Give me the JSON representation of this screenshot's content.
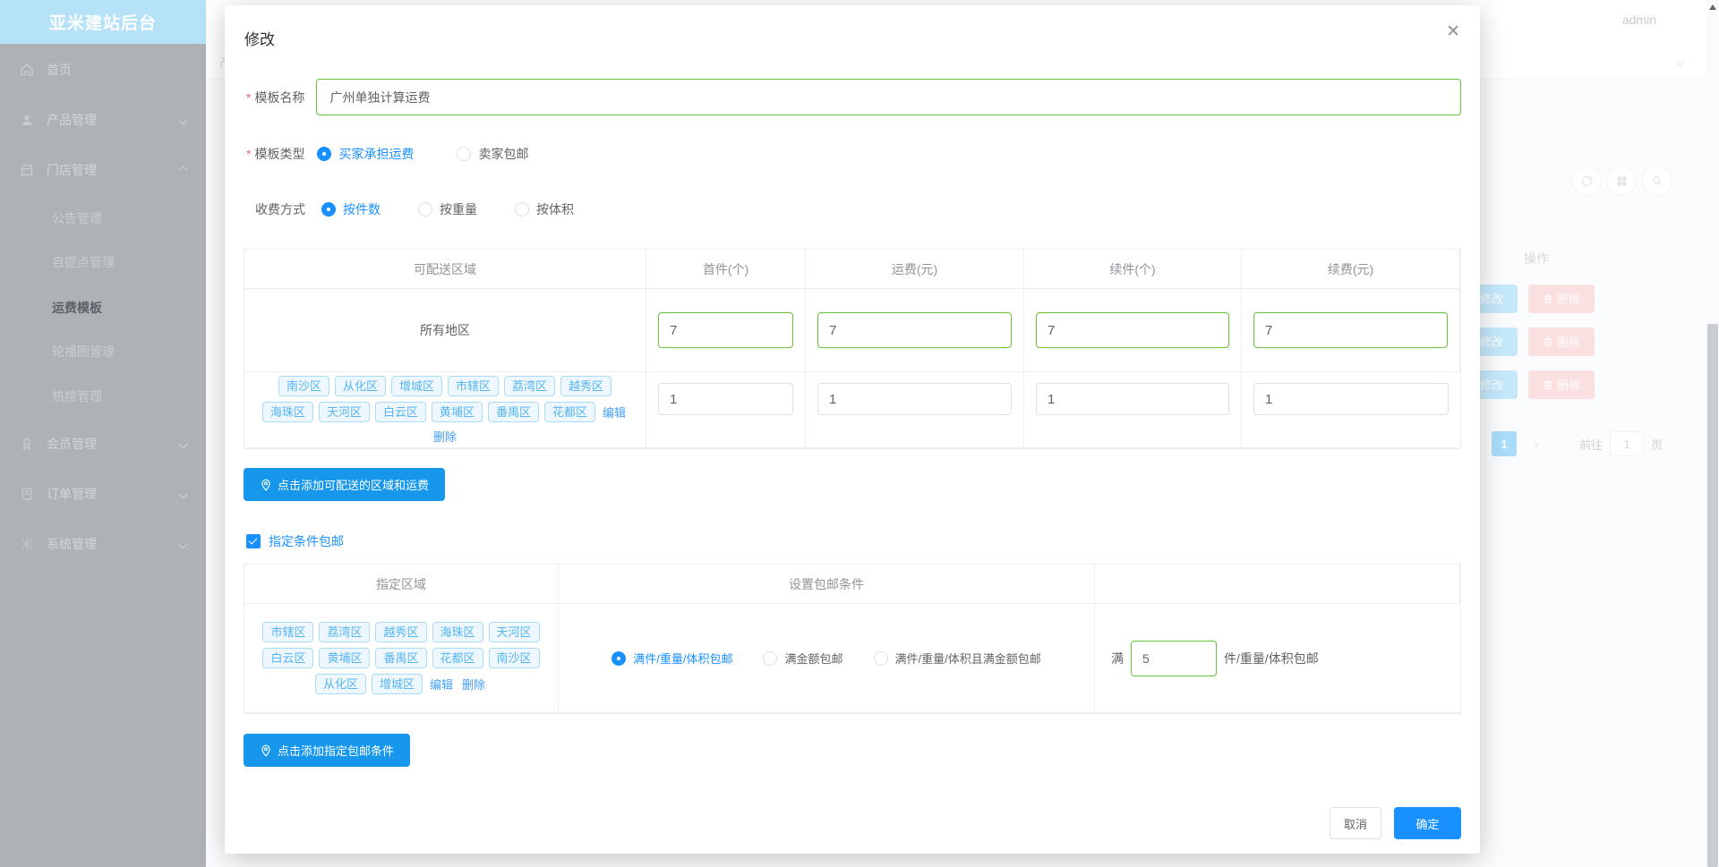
{
  "sidebar": {
    "logo": "亚米建站后台",
    "items": [
      {
        "label": "首页"
      },
      {
        "label": "产品管理"
      },
      {
        "label": "门店管理"
      },
      {
        "label": "会员管理"
      },
      {
        "label": "订单管理"
      },
      {
        "label": "系统管理"
      }
    ],
    "store_children": [
      "公告管理",
      "自提点管理",
      "运费模板",
      "轮播图管理",
      "热搜管理"
    ],
    "active_item": "运费模板"
  },
  "header": {
    "username": "admin"
  },
  "breadcrumb": {
    "visible_text": "产品"
  },
  "background_table": {
    "ops_header": "操作",
    "edit_label": "修改",
    "delete_label": "删除",
    "row_count": 3,
    "pagination": {
      "active_page": "1",
      "goto_label": "前往",
      "page_input": "1",
      "page_suffix": "页"
    }
  },
  "modal": {
    "title": "修改",
    "close_icon": "✕",
    "name_field": {
      "label": "模板名称",
      "value": "广州单独计算运费"
    },
    "type_field": {
      "label": "模板类型",
      "options": [
        "买家承担运费",
        "卖家包邮"
      ],
      "selected": "买家承担运费"
    },
    "method_field": {
      "label": "收费方式",
      "options": [
        "按件数",
        "按重量",
        "按体积"
      ],
      "selected": "按件数"
    },
    "shipping_table": {
      "headers": [
        "可配送区域",
        "首件(个)",
        "运费(元)",
        "续件(个)",
        "续费(元)"
      ],
      "row_all": {
        "region": "所有地区",
        "first": "7",
        "fee": "7",
        "next": "7",
        "next_fee": "7"
      },
      "row_tags": {
        "tags": [
          "南沙区",
          "从化区",
          "增城区",
          "市辖区",
          "荔湾区",
          "越秀区",
          "海珠区",
          "天河区",
          "白云区",
          "黄埔区",
          "番禺区",
          "花都区"
        ],
        "edit": "编辑",
        "delete": "删除",
        "first": "1",
        "fee": "1",
        "next": "1",
        "next_fee": "1"
      }
    },
    "add_region_button": "点击添加可配送的区域和运费",
    "free_shipping": {
      "checkbox_label": "指定条件包邮",
      "checked": true,
      "headers": [
        "指定区域",
        "设置包邮条件"
      ],
      "tags": [
        "市辖区",
        "荔湾区",
        "越秀区",
        "海珠区",
        "天河区",
        "白云区",
        "黄埔区",
        "番禺区",
        "花都区",
        "南沙区",
        "从化区",
        "增城区"
      ],
      "edit": "编辑",
      "delete": "删除",
      "options": [
        "满件/重量/体积包邮",
        "满金额包邮",
        "满件/重量/体积且满金额包邮"
      ],
      "selected": "满件/重量/体积包邮",
      "threshold_prefix": "满",
      "threshold_value": "5",
      "threshold_suffix": "件/重量/体积包邮"
    },
    "add_condition_button": "点击添加指定包邮条件",
    "footer": {
      "cancel": "取消",
      "confirm": "确定"
    }
  },
  "colors": {
    "primary": "#1890ff",
    "success": "#67c23a",
    "danger": "#f56c6c",
    "tag_text": "#55b5f0"
  }
}
